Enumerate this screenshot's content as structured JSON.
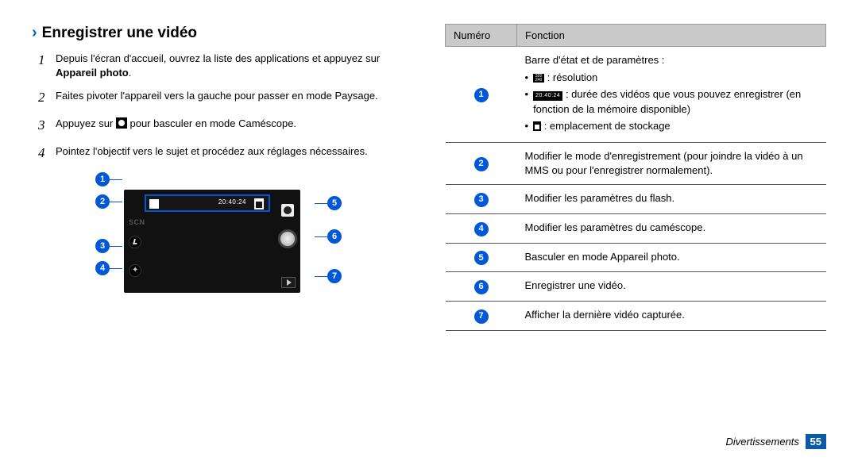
{
  "heading": "Enregistrer une vidéo",
  "steps": {
    "s1_pre": "Depuis l'écran d'accueil, ouvrez la liste des applications et appuyez sur ",
    "s1_bold": "Appareil photo",
    "s1_post": ".",
    "s2": "Faites pivoter l'appareil vers la gauche pour passer en mode Paysage.",
    "s3_pre": "Appuyez sur ",
    "s3_post": " pour basculer en mode Caméscope.",
    "s4": "Pointez l'objectif vers le sujet et procédez aux réglages nécessaires."
  },
  "diagram": {
    "scn": "SCN",
    "time": "20:40:24"
  },
  "table": {
    "head_num": "Numéro",
    "head_fn": "Fonction",
    "row1_intro": "Barre d'état et de paramètres :",
    "row1_b1": ": résolution",
    "row1_b2": ": durée des vidéos que vous pouvez enregistrer (en fonction de la mémoire disponible)",
    "row1_b3": ": emplacement de stockage",
    "row1_time": "20:40:24",
    "row1_res": "320\n240",
    "row2": "Modifier le mode d'enregistrement (pour joindre la vidéo à un MMS ou pour l'enregistrer normalement).",
    "row3": "Modifier les paramètres du flash.",
    "row4": "Modifier les paramètres du caméscope.",
    "row5": "Basculer en mode Appareil photo.",
    "row6": "Enregistrer une vidéo.",
    "row7": "Afficher la dernière vidéo capturée."
  },
  "footer_label": "Divertissements",
  "footer_page": "55"
}
